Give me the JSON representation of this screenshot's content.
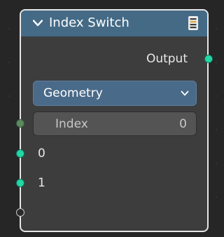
{
  "node": {
    "title": "Index Switch",
    "header_color": "#446a86",
    "collapse_icon": "chevron-down-icon",
    "type_icon": "node-list-icon"
  },
  "output": {
    "label": "Output",
    "socket_color": "#24d6a6"
  },
  "data_type": {
    "value": "Geometry"
  },
  "index_field": {
    "label": "Index",
    "value": "0"
  },
  "inputs": [
    {
      "label": "0",
      "socket_color": "#24d6a6"
    },
    {
      "label": "1",
      "socket_color": "#24d6a6"
    }
  ]
}
